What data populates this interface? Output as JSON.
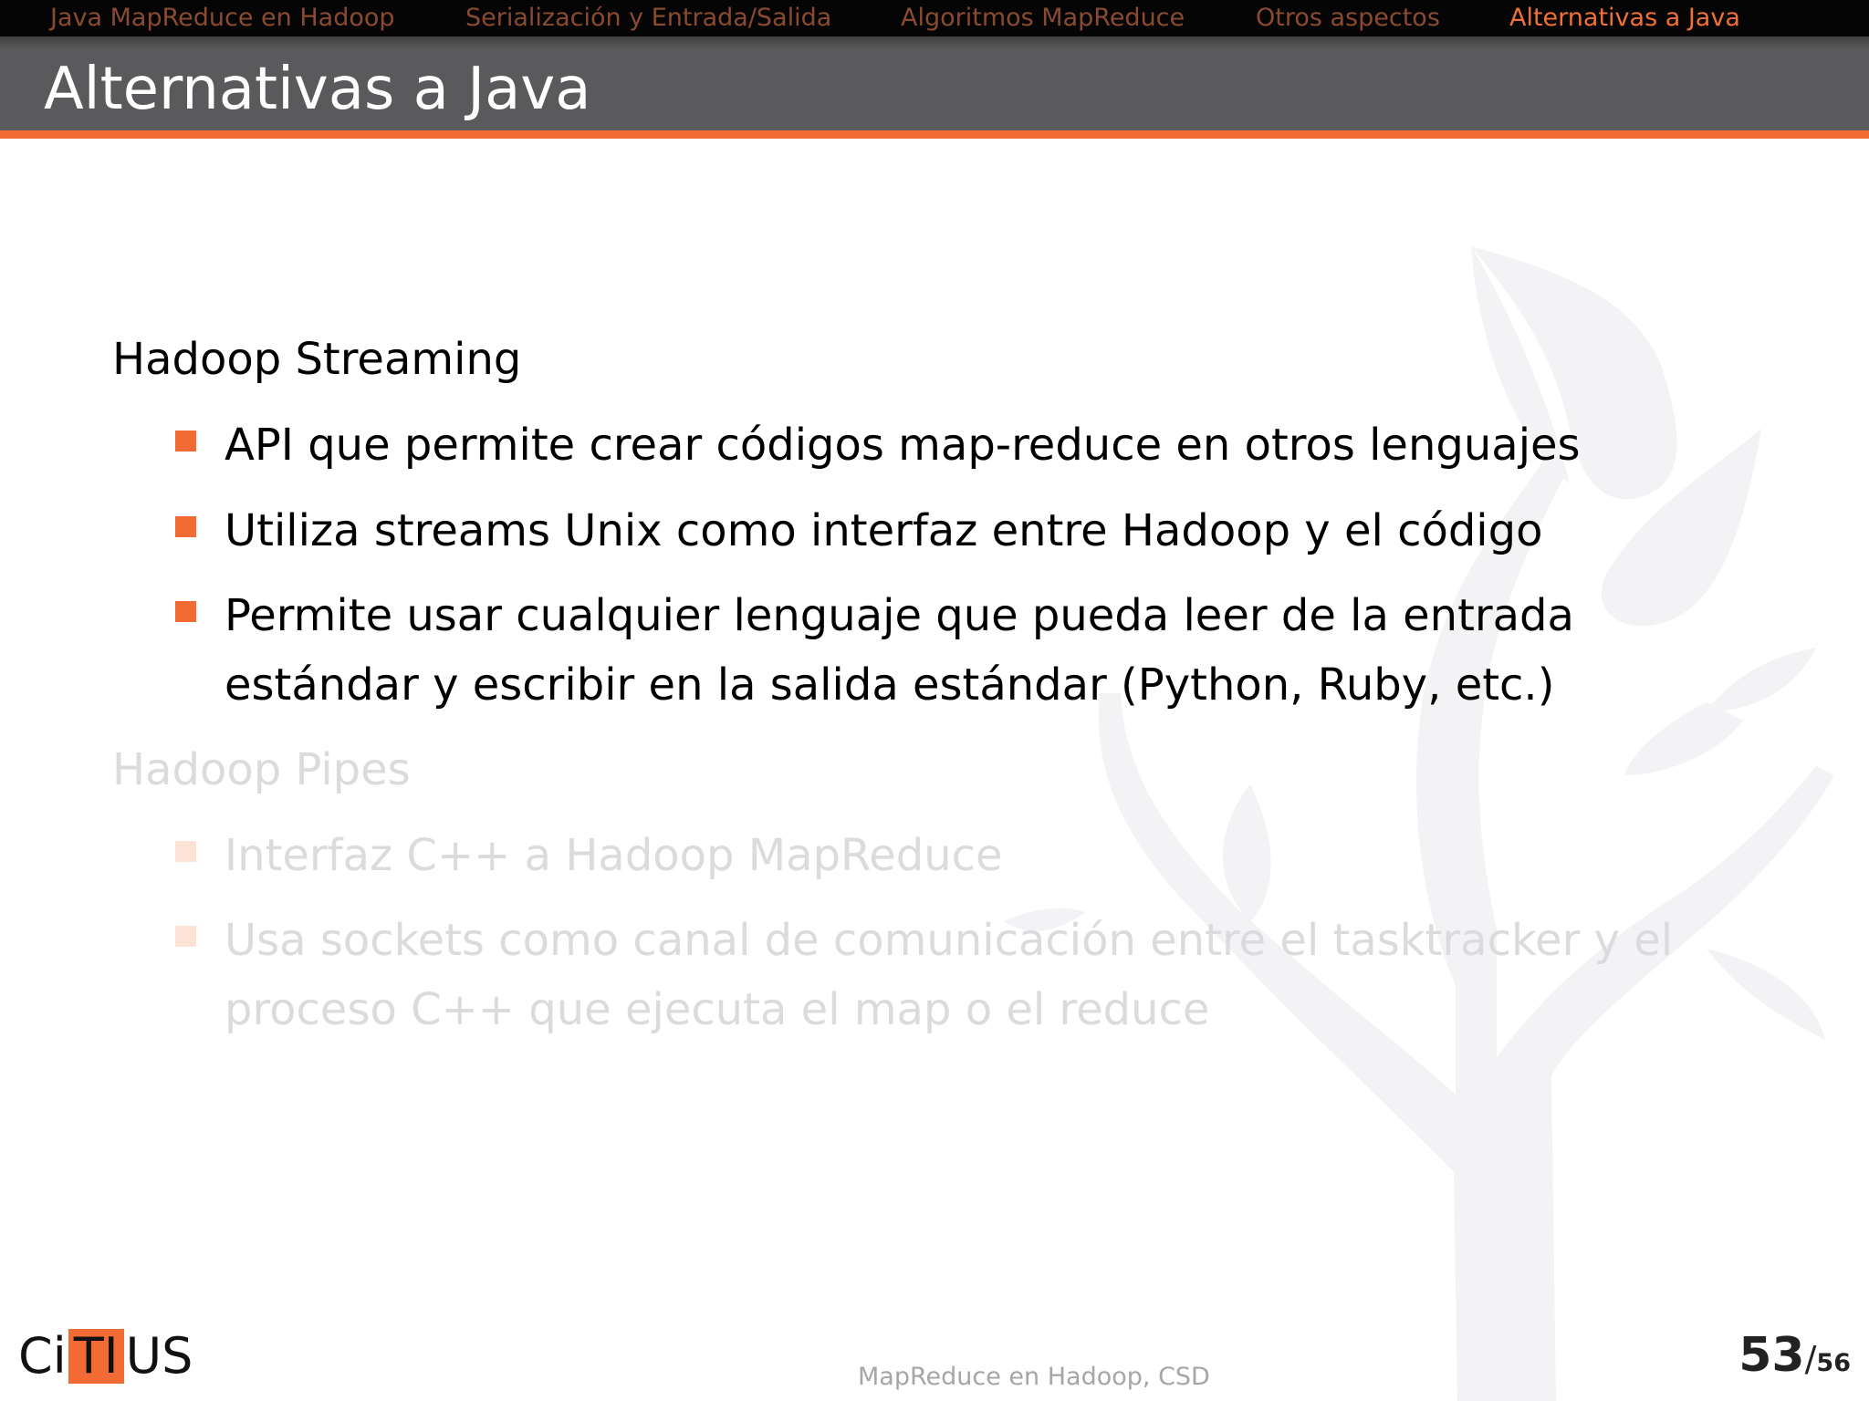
{
  "nav": {
    "items": [
      {
        "label": "Java MapReduce en Hadoop"
      },
      {
        "label": "Serialización y Entrada/Salida"
      },
      {
        "label": "Algoritmos MapReduce"
      },
      {
        "label": "Otros aspectos"
      },
      {
        "label": "Alternativas a Java"
      }
    ]
  },
  "title": "Alternativas a Java",
  "sections": [
    {
      "heading": "Hadoop Streaming",
      "bullets": [
        "API que permite crear códigos map-reduce en otros lenguajes",
        "Utiliza streams Unix como interfaz entre Hadoop y el código",
        "Permite usar cualquier lenguaje que pueda leer de la entrada",
        "estándar y escribir en la salida estándar (Python, Ruby, etc.)"
      ]
    },
    {
      "heading": "Hadoop Pipes",
      "bullets": [
        "Interfaz C++ a Hadoop MapReduce",
        "Usa sockets como canal de comunicación entre el tasktracker y el",
        "proceso C++ que ejecuta el map o el reduce"
      ]
    }
  ],
  "footer": {
    "logo_prefix": "Ci",
    "logo_box": "TI",
    "logo_suffix": "US",
    "center_text": "MapReduce en Hadoop, CSD",
    "page_current": "53",
    "page_separator": "/",
    "page_total": "56"
  },
  "colors": {
    "accent": "#f26b34",
    "title_bar": "#5a595b",
    "nav_bar": "#050505",
    "nav_active": "#f07036",
    "nav_inactive": "#8a4a30",
    "faded_text": "#dcdadd"
  }
}
